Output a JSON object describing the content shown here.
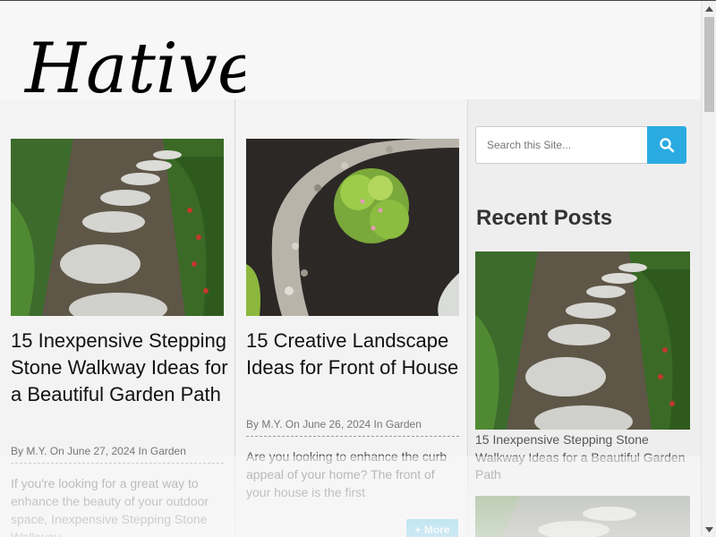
{
  "site": {
    "logo_text": "Hative"
  },
  "posts": [
    {
      "title": "15 Inexpensive Stepping Stone Walkway Ideas for a Beautiful Garden Path",
      "meta": "By M.Y. On June 27, 2024 In Garden",
      "excerpt": "If you're looking for a great way to enhance the beauty of your outdoor space, Inexpensive Stepping Stone Walkway",
      "image": "stepping-stone-path-photo"
    },
    {
      "title": "15 Creative Landscape Ideas for Front of House",
      "meta": "By M.Y. On June 26, 2024 In Garden",
      "excerpt": "Are you looking to enhance the curb appeal of your home? The front of your house is the first",
      "more_label": "+ More",
      "image": "pebble-river-bed-photo"
    }
  ],
  "sidebar": {
    "search_placeholder": "Search this Site...",
    "search_icon": "search-icon",
    "recent_heading": "Recent Posts",
    "recent": [
      {
        "title": "15 Inexpensive Stepping Stone Walkway Ideas for a Beautiful Garden Path",
        "image": "stepping-stone-path-photo"
      }
    ]
  },
  "colors": {
    "accent": "#29abe2",
    "more_button": "#33b3e6",
    "title": "#111111",
    "meta": "#777777"
  }
}
